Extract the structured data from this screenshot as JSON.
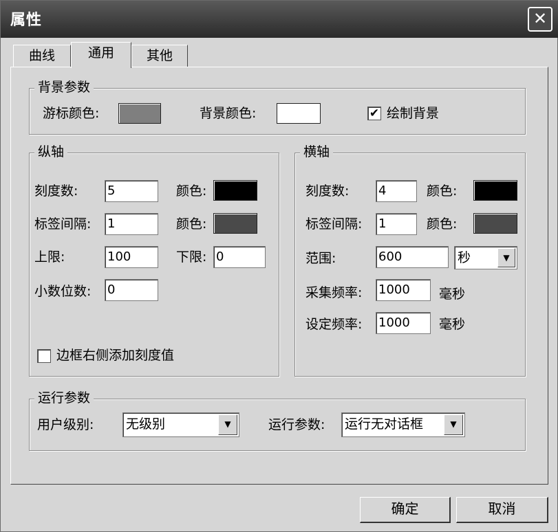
{
  "window": {
    "title": "属性",
    "close_glyph": "✕"
  },
  "tabs": [
    {
      "label": "曲线"
    },
    {
      "label": "通用"
    },
    {
      "label": "其他"
    }
  ],
  "background": {
    "legend": "背景参数",
    "cursor_color_label": "游标颜色:",
    "cursor_color": "#7f7f7f",
    "bg_color_label": "背景颜色:",
    "bg_color": "#ffffff",
    "draw_bg_label": "绘制背景",
    "draw_bg_checked": "✔"
  },
  "vertical": {
    "legend": "纵轴",
    "ticks_label": "刻度数:",
    "ticks_value": "5",
    "color1_label": "颜色:",
    "color1": "#000000",
    "interval_label": "标签间隔:",
    "interval_value": "1",
    "color2_label": "颜色:",
    "color2": "#4a4a4a",
    "upper_label": "上限:",
    "upper_value": "100",
    "lower_label": "下限:",
    "lower_value": "0",
    "decimals_label": "小数位数:",
    "decimals_value": "0",
    "border_ticks_label": "边框右侧添加刻度值"
  },
  "horizontal": {
    "legend": "横轴",
    "ticks_label": "刻度数:",
    "ticks_value": "4",
    "color1_label": "颜色:",
    "color1": "#000000",
    "interval_label": "标签间隔:",
    "interval_value": "1",
    "color2_label": "颜色:",
    "color2": "#4a4a4a",
    "range_label": "范围:",
    "range_value": "600",
    "range_unit": "秒",
    "sample_label": "采集频率:",
    "sample_value": "1000",
    "sample_unit": "毫秒",
    "set_label": "设定频率:",
    "set_value": "1000",
    "set_unit": "毫秒"
  },
  "run": {
    "legend": "运行参数",
    "user_level_label": "用户级别:",
    "user_level_value": "无级别",
    "run_param_label": "运行参数:",
    "run_param_value": "运行无对话框",
    "arrow_glyph": "▼"
  },
  "buttons": {
    "ok": "确定",
    "cancel": "取消"
  }
}
